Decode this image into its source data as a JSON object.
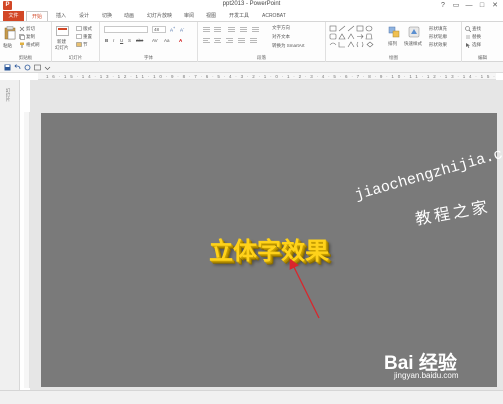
{
  "window": {
    "logo_letter": "P",
    "title": "ppt2013 - PowerPoint",
    "controls": [
      "?",
      "▭",
      "—",
      "□",
      "✕"
    ]
  },
  "tabs": [
    {
      "label": "文件"
    },
    {
      "label": "开始"
    },
    {
      "label": "插入"
    },
    {
      "label": "设计"
    },
    {
      "label": "切换"
    },
    {
      "label": "动画"
    },
    {
      "label": "幻灯片放映"
    },
    {
      "label": "审阅"
    },
    {
      "label": "视图"
    },
    {
      "label": "开发工具"
    },
    {
      "label": "ACROBAT"
    }
  ],
  "ribbon": {
    "clipboard": {
      "label": "剪贴板",
      "paste": "粘贴",
      "cut": "剪切",
      "copy": "复制",
      "format_painter": "格式刷"
    },
    "slides": {
      "label": "幻灯片",
      "new_slide": "新建",
      "new_slide_2": "幻灯片",
      "layout": "版式",
      "reset": "重置",
      "section": "节"
    },
    "font": {
      "label": "字体",
      "size": "48",
      "bold": "B",
      "italic": "I",
      "underline": "U",
      "strike": "S",
      "shadow": "abc",
      "spacing": "AV",
      "case": "Aa",
      "color": "A"
    },
    "paragraph": {
      "label": "段落",
      "text_direction": "文字方向",
      "align_text": "对齐文本",
      "smartart": "转换为 SmartArt"
    },
    "drawing": {
      "label": "绘图",
      "arrange": "排列",
      "quick_styles": "快速样式",
      "fill": "形状填充",
      "outline": "形状轮廓",
      "effects": "形状效果"
    },
    "editing": {
      "label": "编辑",
      "find": "查找",
      "replace": "替换",
      "select": "选择"
    }
  },
  "ruler_ticks": "16·15·14·13·12·11·10·9·8·7·6·5·4·3·2·1·0·1·2·3·4·5·6·7·8·9·10·11·12·13·14·15·16",
  "left_panel_label": "幻灯片",
  "slide": {
    "text": "立体字效果",
    "text_color": "#ffd21a",
    "background": "#7a7a7a"
  },
  "annotation": {
    "arrow_color": "#d9262c"
  },
  "watermarks": {
    "url": "jiaochengzhijia.com",
    "site": "教程之家",
    "baidu": "Bai 经验",
    "baidu_url": "jingyan.baidu.com"
  }
}
